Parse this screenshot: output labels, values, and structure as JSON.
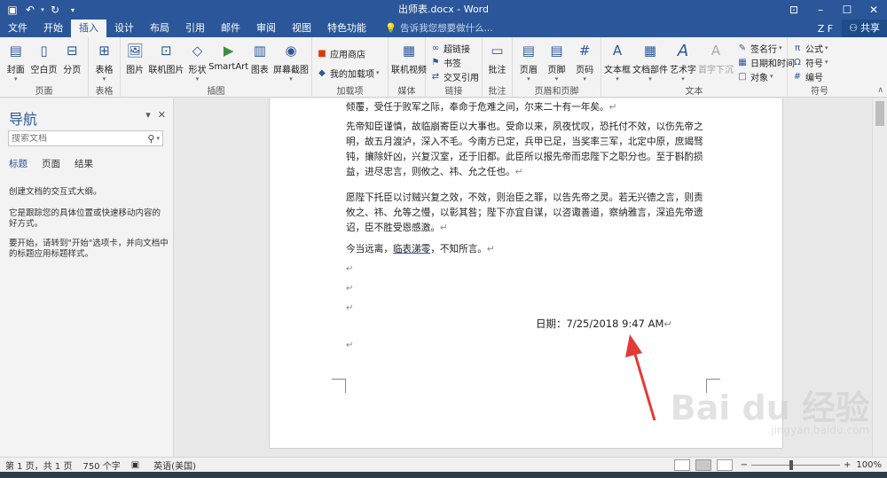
{
  "app": {
    "title": "出师表.docx - Word",
    "user": "Z F",
    "share_label": "共享"
  },
  "tabs": [
    {
      "label": "文件"
    },
    {
      "label": "开始"
    },
    {
      "label": "插入",
      "active": true
    },
    {
      "label": "设计"
    },
    {
      "label": "布局"
    },
    {
      "label": "引用"
    },
    {
      "label": "邮件"
    },
    {
      "label": "审阅"
    },
    {
      "label": "视图"
    },
    {
      "label": "特色功能"
    }
  ],
  "tell_me": "告诉我您想要做什么...",
  "ribbon": {
    "pages": {
      "label": "页面",
      "cover": "封面",
      "blank": "空白页",
      "break": "分页"
    },
    "tables": {
      "label": "表格",
      "table": "表格"
    },
    "illustrations": {
      "label": "插图",
      "picture": "图片",
      "online_picture": "联机图片",
      "shapes": "形状",
      "smartart": "SmartArt",
      "chart": "图表",
      "screenshot": "屏幕截图"
    },
    "addins": {
      "label": "加载项",
      "store": "应用商店",
      "my_addins": "我的加载项"
    },
    "media": {
      "label": "媒体",
      "online_video": "联机视频"
    },
    "links": {
      "label": "链接",
      "hyperlink": "超链接",
      "bookmark": "书签",
      "cross_ref": "交叉引用"
    },
    "comments": {
      "label": "批注",
      "comment": "批注"
    },
    "header_footer": {
      "label": "页眉和页脚",
      "header": "页眉",
      "footer": "页脚",
      "page_number": "页码"
    },
    "text": {
      "label": "文本",
      "textbox": "文本框",
      "quickparts": "文档部件",
      "wordart": "艺术字",
      "dropcap": "首字下沉",
      "signature": "签名行",
      "datetime": "日期和时间",
      "object": "对象"
    },
    "symbols": {
      "label": "符号",
      "equation": "公式",
      "symbol": "符号",
      "numbering": "编号"
    }
  },
  "nav": {
    "title": "导航",
    "search_placeholder": "搜索文档",
    "tabs": [
      "标题",
      "页面",
      "结果"
    ],
    "text1": "创建文档的交互式大纲。",
    "text2": "它是跟踪您的具体位置或快速移动内容的好方式。",
    "text3": "要开始，请转到\"开始\"选项卡，并向文档中的标题应用标题样式。"
  },
  "document": {
    "p0": "倾覆，受任于败军之际，奉命于危难之间，尔来二十有一年矣。",
    "p1": "先帝知臣谨慎，故临崩寄臣以大事也。受命以来，夙夜忧叹，恐托付不效，以伤先帝之明，故五月渡泸，深入不毛。今南方已定，兵甲已足，当奖率三军，北定中原，庶竭驽钝，攘除奸凶，兴复汉室，还于旧都。此臣所以报先帝而忠陛下之职分也。至于斟酌损益，进尽忠言，则攸之、祎、允之任也。",
    "p2": "愿陛下托臣以讨贼兴复之效，不效，则治臣之罪，以告先帝之灵。若无兴德之言，则责攸之、祎、允等之慢，以彰其咎；陛下亦宜自谋，以咨诹善道，察纳雅言，深追先帝遗诏，臣不胜受恩感激。",
    "p3_before": "今当远离，",
    "p3_under": "临表涕零",
    "p3_after": "，不知所言。",
    "date_line": "日期：7/25/2018 9:47 AM",
    "para_mark": "↵"
  },
  "status": {
    "page": "第 1 页，共 1 页",
    "words": "750 个字",
    "language": "英语(美国)",
    "zoom": "100%",
    "zoom_level": 1.0
  },
  "watermark": {
    "logo": "Bai du 经验",
    "url": "jingyan.baidu.com"
  },
  "colors": {
    "accent": "#2b579a",
    "arrow": "#e53935"
  }
}
